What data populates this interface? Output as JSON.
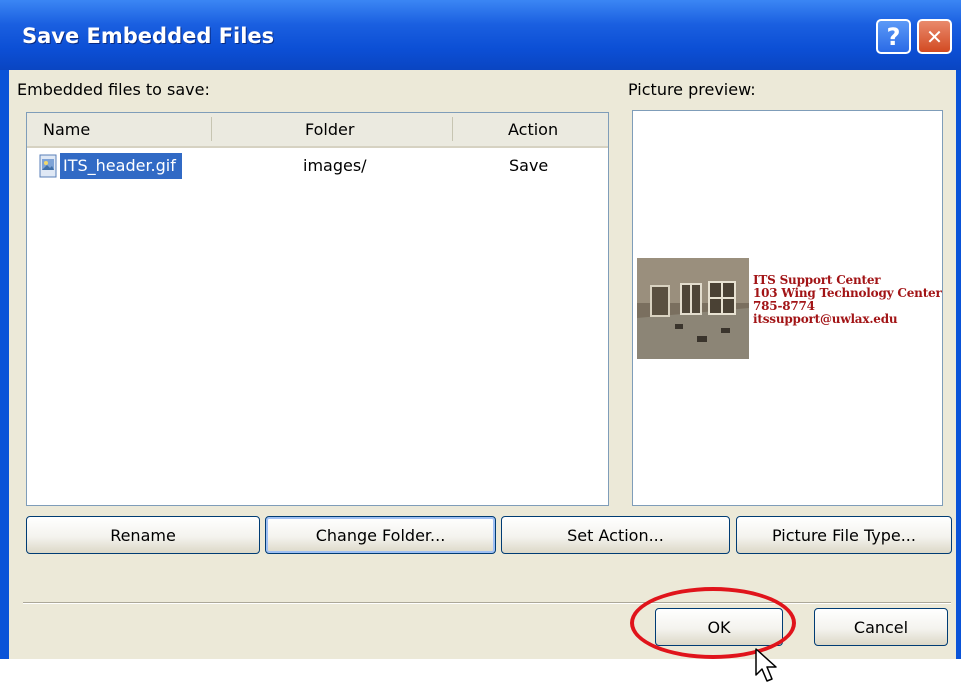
{
  "window": {
    "title": "Save Embedded Files",
    "help_glyph": "?",
    "close_glyph": "✕"
  },
  "files_section": {
    "label": "Embedded files to save:",
    "columns": [
      "Name",
      "Folder",
      "Action"
    ],
    "rows": [
      {
        "name": "ITS_header.gif",
        "folder": "images/",
        "action": "Save",
        "icon": "image-file-icon",
        "selected": true
      }
    ]
  },
  "preview_section": {
    "label": "Picture preview:",
    "image_lines": [
      "ITS Support Center",
      "103 Wing Technology Center",
      "785-8774",
      "itssupport@uwlax.edu"
    ]
  },
  "actions": {
    "rename": "Rename",
    "change_folder": "Change Folder...",
    "set_action": "Set Action...",
    "picture_file_type": "Picture File Type..."
  },
  "footer": {
    "ok": "OK",
    "cancel": "Cancel"
  },
  "colors": {
    "title_bar": "#0a53d8",
    "selection": "#316ac5",
    "highlight_annotation": "#e0141b",
    "preview_text": "#a21416"
  }
}
